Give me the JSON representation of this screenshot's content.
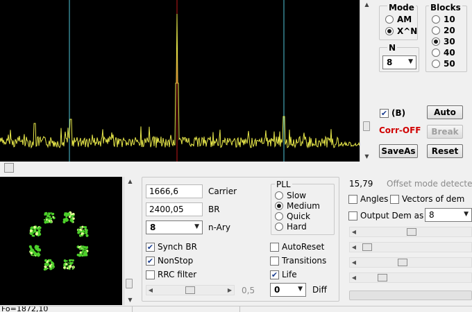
{
  "mode_group": {
    "title": "Mode",
    "options": [
      {
        "label": "AM",
        "selected": false
      },
      {
        "label": "X^N",
        "selected": true
      }
    ]
  },
  "blocks_group": {
    "title": "Blocks",
    "options": [
      {
        "label": "10",
        "selected": false
      },
      {
        "label": "20",
        "selected": false
      },
      {
        "label": "30",
        "selected": true
      },
      {
        "label": "40",
        "selected": false
      },
      {
        "label": "50",
        "selected": false
      }
    ]
  },
  "n_group": {
    "title": "N",
    "value": "8"
  },
  "top_controls": {
    "b_checkbox": {
      "label": "(B)",
      "checked": true
    },
    "auto_button": "Auto",
    "break_button": "Break",
    "corr_status": "Corr-OFF",
    "saveas_button": "SaveAs",
    "reset_button": "Reset",
    "corr_color": "#d00000"
  },
  "demod": {
    "carrier_value": "1666,6",
    "carrier_label": "Carrier",
    "br_value": "2400,05",
    "br_label": "BR",
    "nary_value": "8",
    "nary_label": "n-Ary",
    "synch_br": {
      "label": "Synch BR",
      "checked": true
    },
    "nonstop": {
      "label": "NonStop",
      "checked": true
    },
    "rrc_filter": {
      "label": "RRC filter",
      "checked": false
    },
    "slider_value": "0,5",
    "autoreset": {
      "label": "AutoReset",
      "checked": false
    },
    "transitions": {
      "label": "Transitions",
      "checked": false
    },
    "life": {
      "label": "Life",
      "checked": true
    },
    "diff_value": "0",
    "diff_label": "Diff"
  },
  "pll_group": {
    "title": "PLL",
    "options": [
      {
        "label": "Slow",
        "selected": false
      },
      {
        "label": "Medium",
        "selected": true
      },
      {
        "label": "Quick",
        "selected": false
      },
      {
        "label": "Hard",
        "selected": false
      }
    ]
  },
  "right_panel": {
    "offset_value": "15,79",
    "offset_status": "Offset mode detected",
    "angles": {
      "label": "Angles",
      "checked": false
    },
    "vectors": {
      "label": "Vectors of dem",
      "checked": false
    },
    "output_dem": {
      "label": "Output Dem as",
      "checked": false
    },
    "output_dem_value": "8"
  },
  "status_bar": {
    "text": "Fo=1872,10"
  },
  "colors": {
    "spectrum_trace": "#e8e84a",
    "marker_cyan": "#4fc6d8",
    "marker_red": "#c01818",
    "constellation": "#4ccf2a"
  },
  "icons": [
    "scroll-up-arrow",
    "scroll-down-arrow",
    "dropdown-chevron",
    "checkmark"
  ]
}
